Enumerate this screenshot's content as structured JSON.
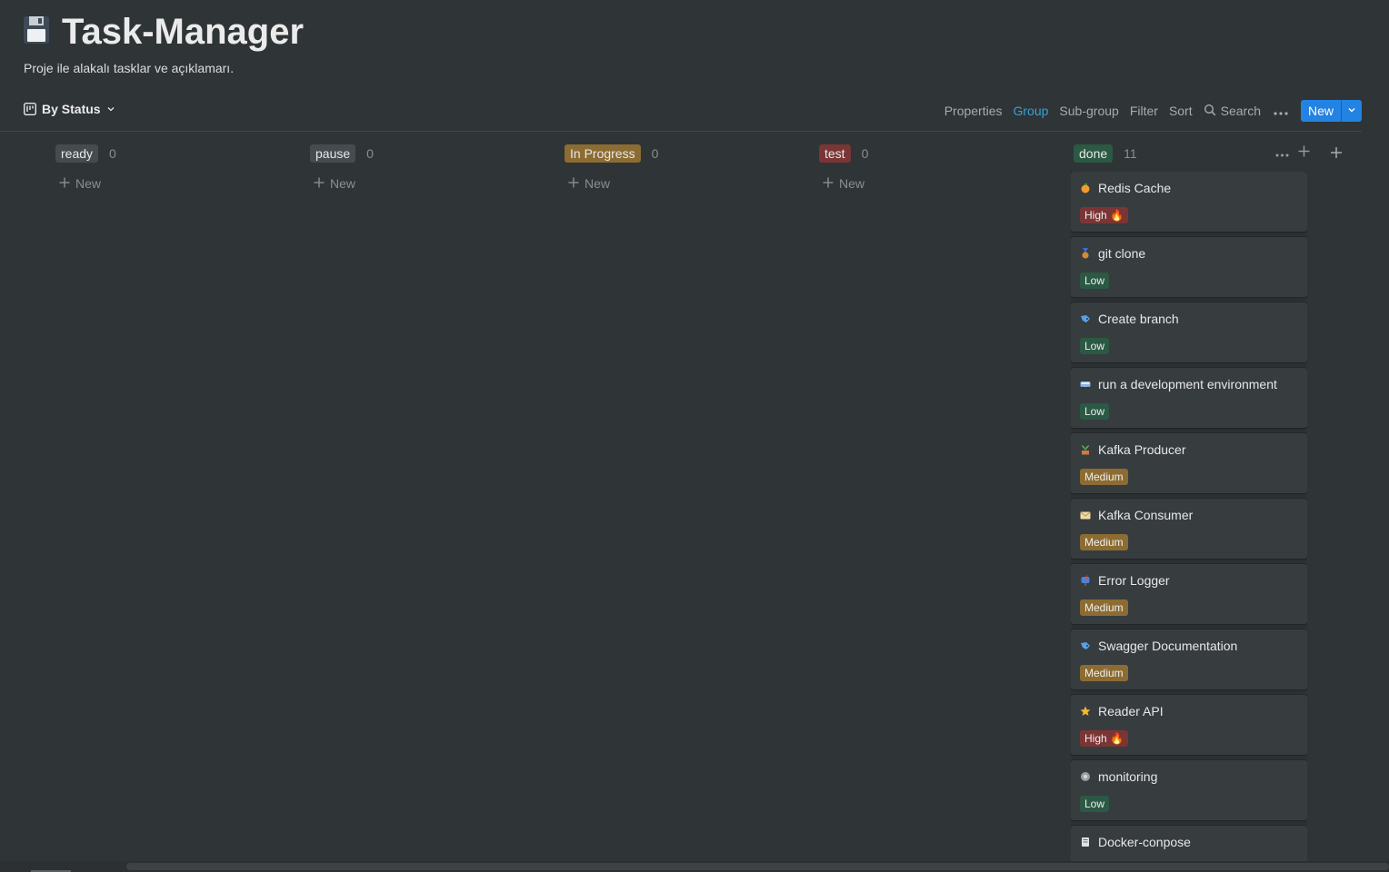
{
  "page": {
    "icon": "floppy-disk-icon",
    "title": "Task-Manager",
    "description": "Proje ile alakalı tasklar ve açıklamarı."
  },
  "view": {
    "name": "By Status",
    "icon": "board-icon"
  },
  "toolbar": {
    "properties": "Properties",
    "group": "Group",
    "subgroup": "Sub-group",
    "filter": "Filter",
    "sort": "Sort",
    "search": "Search",
    "new": "New",
    "active": "Group"
  },
  "columns": [
    {
      "name": "ready",
      "count": "0",
      "color": "#454b4e",
      "new_label": "New"
    },
    {
      "name": "pause",
      "count": "0",
      "color": "#454b4e",
      "new_label": "New"
    },
    {
      "name": "In Progress",
      "count": "0",
      "color": "#8c6c32",
      "new_label": "New"
    },
    {
      "name": "test",
      "count": "0",
      "color": "#7b3535",
      "new_label": "New"
    },
    {
      "name": "done",
      "count": "11",
      "color": "#2b5944"
    }
  ],
  "priority_colors": {
    "High": "#7b3535",
    "Low": "#2b5944",
    "Medium": "#8c6c32"
  },
  "cards": [
    {
      "title": "Redis Cache",
      "icon": "orange-icon",
      "priority": "High 🔥"
    },
    {
      "title": "git clone",
      "icon": "medal-icon",
      "priority": "Low"
    },
    {
      "title": "Create branch",
      "icon": "fishing-lure-icon",
      "priority": "Low"
    },
    {
      "title": "run a development environment",
      "icon": "bus-icon",
      "priority": "Low"
    },
    {
      "title": "Kafka Producer",
      "icon": "plant-icon",
      "priority": "Medium"
    },
    {
      "title": "Kafka Consumer",
      "icon": "envelope-icon",
      "priority": "Medium"
    },
    {
      "title": "Error Logger",
      "icon": "mailbox-icon",
      "priority": "Medium"
    },
    {
      "title": "Swagger Documentation",
      "icon": "fishing-lure-icon",
      "priority": "Medium"
    },
    {
      "title": "Reader API",
      "icon": "star-icon",
      "priority": "High 🔥"
    },
    {
      "title": "monitoring",
      "icon": "gear-icon",
      "priority": "Low"
    },
    {
      "title": "Docker-conpose",
      "icon": "document-icon",
      "priority": ""
    }
  ]
}
